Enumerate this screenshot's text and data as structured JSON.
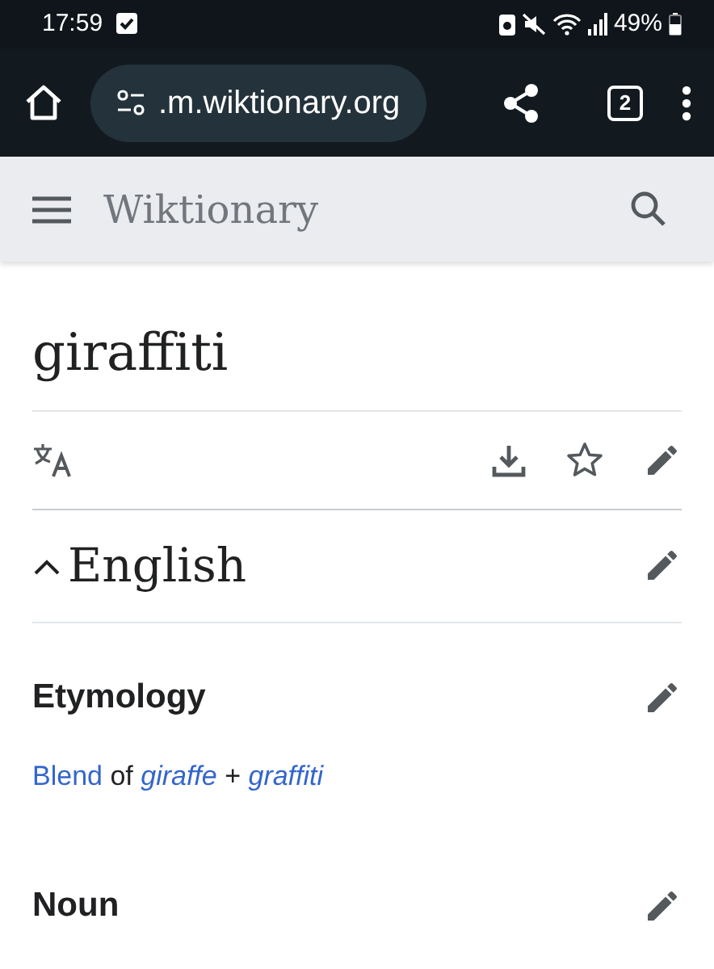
{
  "status_bar": {
    "time": "17:59",
    "battery": "49%"
  },
  "browser": {
    "url": ".m.wiktionary.org",
    "tab_count": "2"
  },
  "header": {
    "site_title": "Wiktionary"
  },
  "page": {
    "title": "giraffiti"
  },
  "language_section": {
    "heading": "English",
    "expanded": true
  },
  "sections": [
    {
      "heading": "Etymology",
      "body": [
        {
          "text": "Blend",
          "kind": "link"
        },
        {
          "text": " of ",
          "kind": "plain"
        },
        {
          "text": "giraffe",
          "kind": "italic-link"
        },
        {
          "text": " + ",
          "kind": "plain"
        },
        {
          "text": "graffiti",
          "kind": "italic-link"
        }
      ]
    },
    {
      "heading": "Noun"
    }
  ]
}
